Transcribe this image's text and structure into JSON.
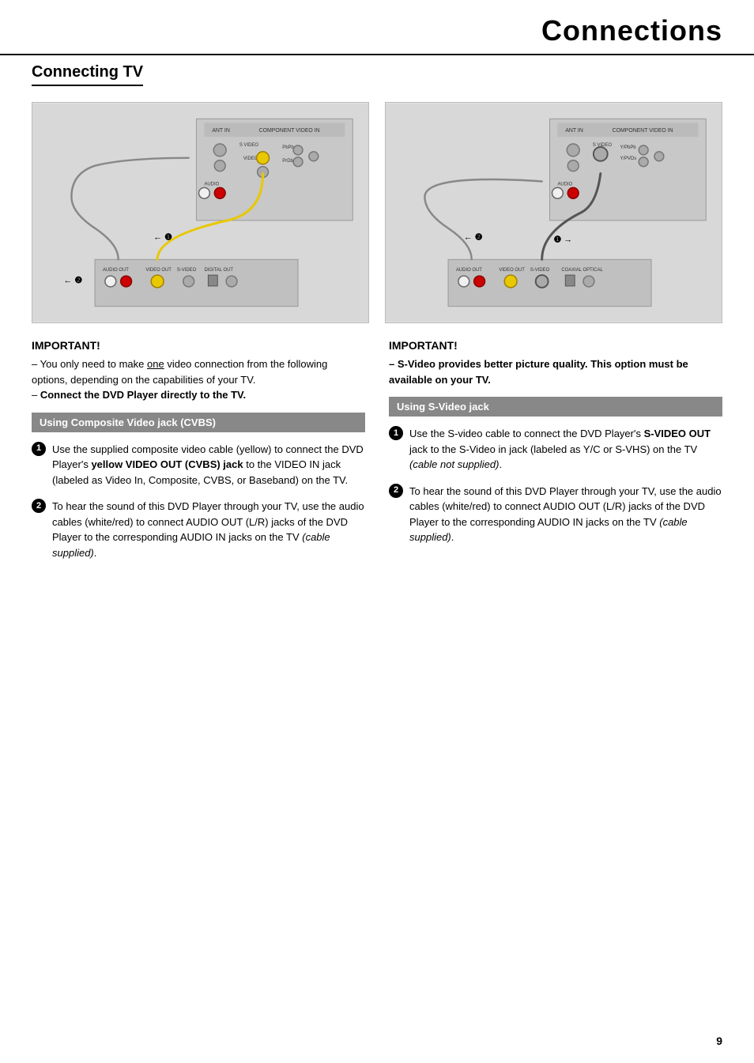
{
  "header": {
    "title": "Connections"
  },
  "section": {
    "title": "Connecting TV"
  },
  "left_column": {
    "important_label": "IMPORTANT!",
    "important_lines": [
      "– You only need to make one video connection from the following options, depending on the capabilities of your TV.",
      "– Connect the DVD Player directly to the TV."
    ],
    "section_bar": "Using Composite Video jack (CVBS)",
    "items": [
      {
        "number": "1",
        "text": "Use the supplied composite video cable (yellow) to connect the DVD Player's yellow VIDEO OUT (CVBS) jack to the VIDEO IN jack (labeled as Video In, Composite, CVBS, or Baseband) on the TV."
      },
      {
        "number": "2",
        "text": "To hear the sound of this DVD Player through your TV, use the audio cables (white/red) to connect AUDIO OUT (L/R) jacks of the DVD Player to the corresponding AUDIO IN jacks on the TV (cable supplied)."
      }
    ]
  },
  "right_column": {
    "important_label": "IMPORTANT!",
    "important_lines": [
      "– S-Video provides better picture quality. This option must be available on your TV."
    ],
    "section_bar": "Using S-Video jack",
    "items": [
      {
        "number": "1",
        "text": "Use the S-video cable to connect the DVD Player's S-VIDEO OUT jack to the S-Video in jack (labeled as Y/C or S-VHS) on the TV (cable not supplied)."
      },
      {
        "number": "2",
        "text": "To hear the sound of this DVD Player through your TV, use the audio cables (white/red) to connect AUDIO OUT (L/R) jacks of the DVD Player to the corresponding AUDIO IN jacks on the TV (cable supplied)."
      }
    ]
  },
  "page_number": "9"
}
